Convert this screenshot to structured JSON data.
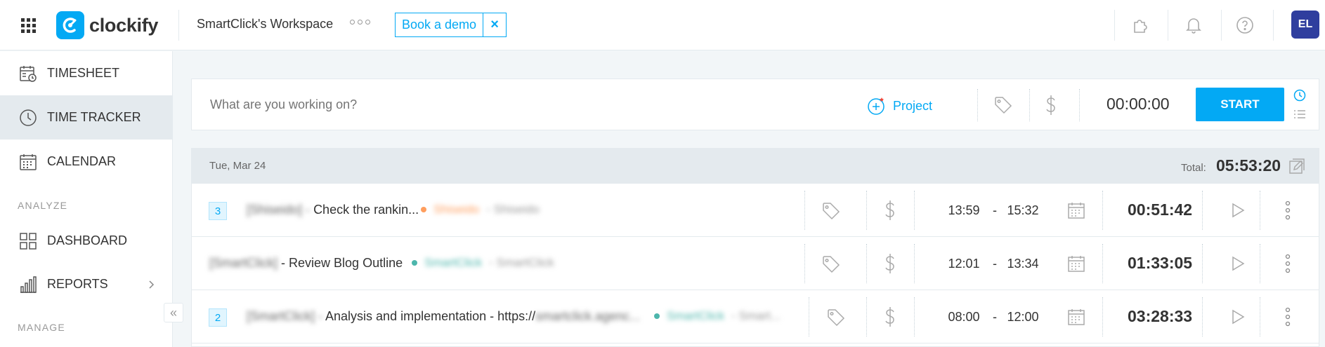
{
  "app": {
    "name": "clockify"
  },
  "header": {
    "workspace": "SmartClick's Workspace",
    "demo_label": "Book a demo",
    "demo_close": "×",
    "avatar_initials": "EL"
  },
  "sidebar": {
    "items": [
      {
        "label": "TIMESHEET",
        "icon": "timesheet-icon"
      },
      {
        "label": "TIME TRACKER",
        "icon": "clock-icon",
        "active": true
      },
      {
        "label": "CALENDAR",
        "icon": "calendar-icon"
      },
      {
        "label": "DASHBOARD",
        "icon": "dashboard-icon"
      },
      {
        "label": "REPORTS",
        "icon": "reports-icon"
      }
    ],
    "sections": {
      "analyze": "ANALYZE",
      "manage": "MANAGE"
    },
    "collapse": "«"
  },
  "timer": {
    "placeholder": "What are you working on?",
    "project_label": "Project",
    "time": "00:00:00",
    "start_label": "START"
  },
  "day": {
    "date": "Tue, Mar 24",
    "total_label": "Total:",
    "total": "05:53:20"
  },
  "entries": [
    {
      "count": "3",
      "desc_prefix": "[Shiseido] -",
      "desc": "Check the rankin...",
      "project": "Shiseido",
      "client": "- Shiseido",
      "project_color": "#ff9e5e",
      "start": "13:59",
      "dash": "-",
      "end": "15:32",
      "duration": "00:51:42"
    },
    {
      "count": "",
      "desc_prefix": "[SmartClick]",
      "desc": "- Review Blog Outline",
      "project": "SmartClick",
      "client": "- SmartClick",
      "project_color": "#4db6ac",
      "start": "12:01",
      "dash": "-",
      "end": "13:34",
      "duration": "01:33:05"
    },
    {
      "count": "2",
      "desc_prefix": "[SmartClick] -",
      "desc": "Analysis and implementation - https://",
      "desc_suffix": "smartclick.agenc...",
      "project": "SmartClick",
      "client": "- Smart...",
      "project_color": "#4db6ac",
      "start": "08:00",
      "dash": "-",
      "end": "12:00",
      "duration": "03:28:33"
    }
  ],
  "colors": {
    "accent": "#03a9f4",
    "avatar": "#2f3e9e",
    "sidebar_active": "#e4eaee"
  }
}
